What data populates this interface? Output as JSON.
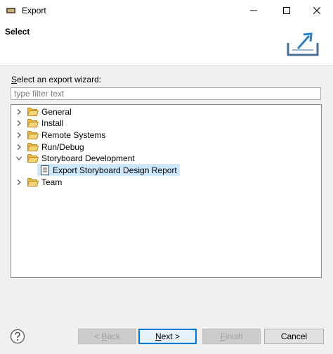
{
  "window": {
    "title": "Export"
  },
  "banner": {
    "title": "Select"
  },
  "prompt": {
    "mnemonic": "S",
    "rest": "elect an export wizard:"
  },
  "filter": {
    "placeholder": "type filter text",
    "value": ""
  },
  "tree": {
    "items": [
      {
        "label": "General",
        "expanded": false
      },
      {
        "label": "Install",
        "expanded": false
      },
      {
        "label": "Remote Systems",
        "expanded": false
      },
      {
        "label": "Run/Debug",
        "expanded": false
      },
      {
        "label": "Storyboard Development",
        "expanded": true
      },
      {
        "label": "Team",
        "expanded": false
      }
    ],
    "child": {
      "label": "Export Storyboard Design Report",
      "selected": true
    }
  },
  "buttons": {
    "back_prefix": "< ",
    "back_mnemonic": "B",
    "back_rest": "ack",
    "next_mnemonic": "N",
    "next_rest": "ext >",
    "finish_mnemonic": "F",
    "finish_rest": "inish",
    "cancel": "Cancel"
  },
  "icons": {
    "app": "eclipse-app-icon",
    "banner": "export-wizard-icon",
    "folder": "folder-icon",
    "report": "report-document-icon",
    "help": "help-icon"
  },
  "colors": {
    "selection": "#cce8ff",
    "default_button_border": "#0078d7",
    "folder": "#e8b84a"
  }
}
